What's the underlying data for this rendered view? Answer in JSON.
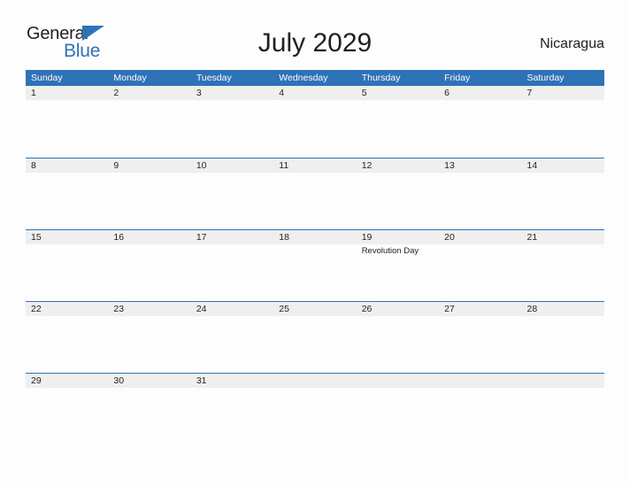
{
  "brand": {
    "name_part1": "General",
    "name_part2": "Blue",
    "flag_icon": "blue-triangle-flag",
    "accent_color": "#2e72b8"
  },
  "header": {
    "title": "July 2029",
    "locale": "Nicaragua"
  },
  "calendar": {
    "header_bg": "#2e72b8",
    "band_bg": "#efefef",
    "weekdays": [
      "Sunday",
      "Monday",
      "Tuesday",
      "Wednesday",
      "Thursday",
      "Friday",
      "Saturday"
    ],
    "weeks": [
      [
        {
          "day": "1",
          "events": []
        },
        {
          "day": "2",
          "events": []
        },
        {
          "day": "3",
          "events": []
        },
        {
          "day": "4",
          "events": []
        },
        {
          "day": "5",
          "events": []
        },
        {
          "day": "6",
          "events": []
        },
        {
          "day": "7",
          "events": []
        }
      ],
      [
        {
          "day": "8",
          "events": []
        },
        {
          "day": "9",
          "events": []
        },
        {
          "day": "10",
          "events": []
        },
        {
          "day": "11",
          "events": []
        },
        {
          "day": "12",
          "events": []
        },
        {
          "day": "13",
          "events": []
        },
        {
          "day": "14",
          "events": []
        }
      ],
      [
        {
          "day": "15",
          "events": []
        },
        {
          "day": "16",
          "events": []
        },
        {
          "day": "17",
          "events": []
        },
        {
          "day": "18",
          "events": []
        },
        {
          "day": "19",
          "events": [
            "Revolution Day"
          ]
        },
        {
          "day": "20",
          "events": []
        },
        {
          "day": "21",
          "events": []
        }
      ],
      [
        {
          "day": "22",
          "events": []
        },
        {
          "day": "23",
          "events": []
        },
        {
          "day": "24",
          "events": []
        },
        {
          "day": "25",
          "events": []
        },
        {
          "day": "26",
          "events": []
        },
        {
          "day": "27",
          "events": []
        },
        {
          "day": "28",
          "events": []
        }
      ],
      [
        {
          "day": "29",
          "events": []
        },
        {
          "day": "30",
          "events": []
        },
        {
          "day": "31",
          "events": []
        },
        {
          "day": "",
          "events": []
        },
        {
          "day": "",
          "events": []
        },
        {
          "day": "",
          "events": []
        },
        {
          "day": "",
          "events": []
        }
      ]
    ]
  }
}
